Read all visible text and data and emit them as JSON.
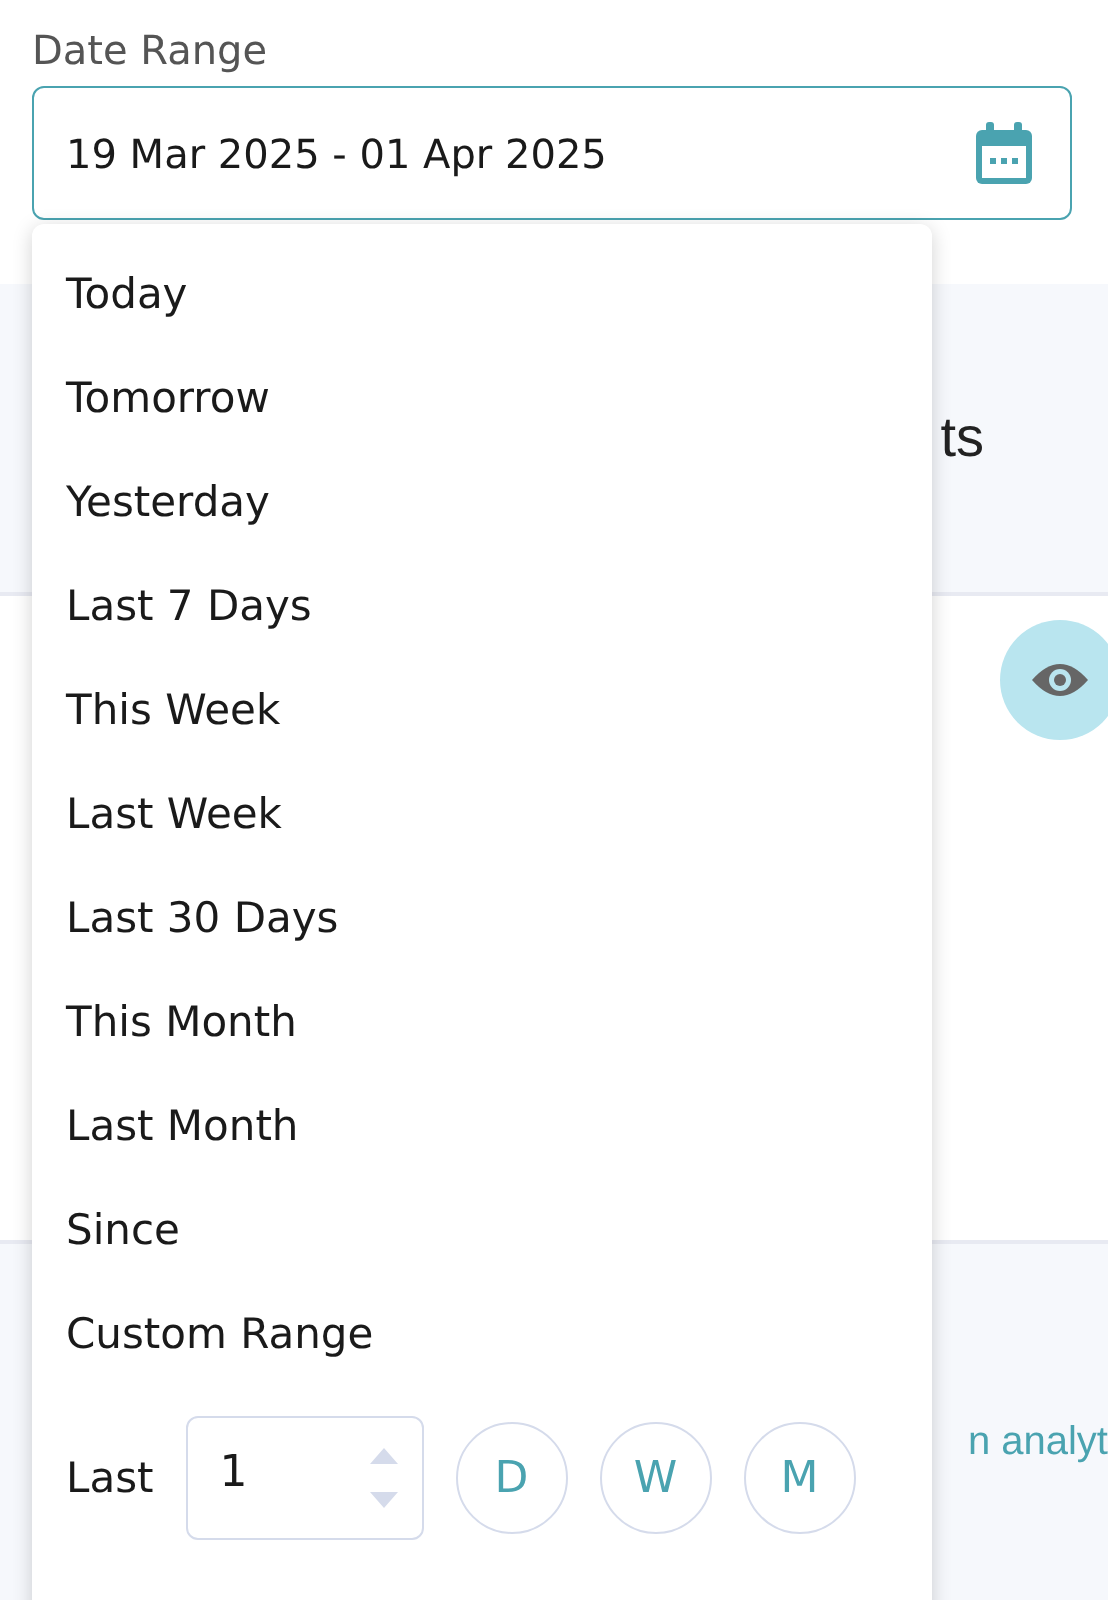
{
  "date_range": {
    "label": "Date Range",
    "value": "19 Mar 2025 - 01 Apr 2025",
    "expanded": true
  },
  "presets": [
    "Today",
    "Tomorrow",
    "Yesterday",
    "Last 7 Days",
    "This Week",
    "Last Week",
    "Last 30 Days",
    "This Month",
    "Last Month",
    "Since",
    "Custom Range"
  ],
  "last": {
    "label": "Last",
    "value": "1",
    "units": [
      "D",
      "W",
      "M"
    ]
  },
  "background": {
    "heading": "ts",
    "link_right": "n analyt"
  }
}
